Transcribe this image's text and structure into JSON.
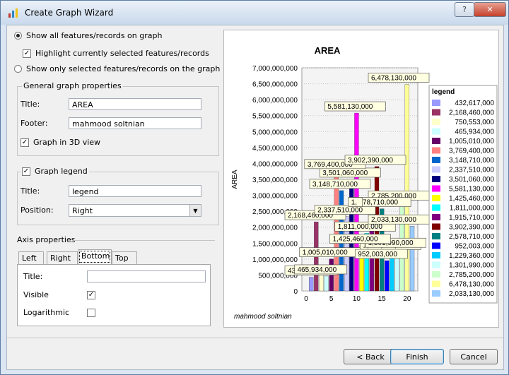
{
  "window": {
    "title": "Create Graph Wizard",
    "help_label": "?",
    "close_label": "✕"
  },
  "options": {
    "show_all": "Show all features/records on graph",
    "highlight": "Highlight currently selected features/records",
    "show_selected": "Show only selected features/records on the graph"
  },
  "general": {
    "group_title": "General graph properties",
    "title_label": "Title:",
    "title_value": "AREA",
    "footer_label": "Footer:",
    "footer_value": "mahmood soltnian",
    "graph3d_label": "Graph in 3D view"
  },
  "legend_group": {
    "checkbox_label": "Graph legend",
    "title_label": "Title:",
    "title_value": "legend",
    "position_label": "Position:",
    "position_value": "Right",
    "dropdown_glyph": "▼"
  },
  "axis": {
    "group_title": "Axis properties",
    "tabs": [
      "Left",
      "Right",
      "Bottom",
      "Top"
    ],
    "title_label": "Title:",
    "title_value": "",
    "visible_label": "Visible",
    "logarithmic_label": "Logarithmic",
    "check_glyph": "✓"
  },
  "buttons": {
    "back": "< Back",
    "finish": "Finish",
    "cancel": "Cancel"
  },
  "chart_data": {
    "type": "bar",
    "title": "AREA",
    "footer": "mahmood soltnian",
    "ylabel": "AREA",
    "ylim": [
      0,
      7000000000
    ],
    "yticks": [
      "0",
      "500,000,000",
      "1,000,000,000",
      "1,500,000,000",
      "2,000,000,000",
      "2,500,000,000",
      "3,000,000,000",
      "3,500,000,000",
      "4,000,000,000",
      "4,500,000,000",
      "5,000,000,000",
      "5,500,000,000",
      "6,000,000,000",
      "6,500,000,000",
      "7,000,000,000"
    ],
    "xlim": [
      0,
      21
    ],
    "xticks": [
      "0",
      "5",
      "10",
      "15",
      "20"
    ],
    "legend_title": "legend",
    "legend_position": "right",
    "series": [
      {
        "name": "432,617,000",
        "x": 1,
        "value": 432617000,
        "color": "#9999ff"
      },
      {
        "name": "2,168,460,000",
        "x": 2,
        "value": 2168460000,
        "color": "#993366"
      },
      {
        "name": "750,553,000",
        "x": 3,
        "value": 750553000,
        "color": "#ffffcc"
      },
      {
        "name": "465,934,000",
        "x": 4,
        "value": 465934000,
        "color": "#ccffff"
      },
      {
        "name": "1,005,010,000",
        "x": 5,
        "value": 1005010000,
        "color": "#660066"
      },
      {
        "name": "3,769,400,000",
        "x": 6,
        "value": 3769400000,
        "color": "#ff8080"
      },
      {
        "name": "3,148,710,000",
        "x": 7,
        "value": 3148710000,
        "color": "#0066cc"
      },
      {
        "name": "2,337,510,000",
        "x": 8,
        "value": 2337510000,
        "color": "#ccccff"
      },
      {
        "name": "3,501,060,000",
        "x": 9,
        "value": 3501060000,
        "color": "#000080"
      },
      {
        "name": "5,581,130,000",
        "x": 10,
        "value": 5581130000,
        "color": "#ff00ff"
      },
      {
        "name": "1,425,460,000",
        "x": 11,
        "value": 1425460000,
        "color": "#ffff00"
      },
      {
        "name": "1,811,000,000",
        "x": 12,
        "value": 1811000000,
        "color": "#00ffff"
      },
      {
        "name": "1,915,710,000",
        "x": 13,
        "value": 1915710000,
        "color": "#800080"
      },
      {
        "name": "3,902,390,000",
        "x": 14,
        "value": 3902390000,
        "color": "#800000"
      },
      {
        "name": "2,578,710,000",
        "x": 15,
        "value": 2578710000,
        "color": "#008080"
      },
      {
        "name": "952,003,000",
        "x": 16,
        "value": 952003000,
        "color": "#0000ff"
      },
      {
        "name": "1,229,360,000",
        "x": 17,
        "value": 1229360000,
        "color": "#00ccff"
      },
      {
        "name": "1,301,990,000",
        "x": 18,
        "value": 1301990000,
        "color": "#ccffff"
      },
      {
        "name": "2,785,200,000",
        "x": 19,
        "value": 2785200000,
        "color": "#ccffcc"
      },
      {
        "name": "6,478,130,000",
        "x": 20,
        "value": 6478130000,
        "color": "#ffff99"
      },
      {
        "name": "2,033,130,000",
        "x": 21,
        "value": 2033130000,
        "color": "#99ccff"
      }
    ],
    "callouts": [
      "432,617,000",
      "465,934,000",
      "1,005,010,000",
      "2,168,460,000",
      "2,337,510,000",
      "3,148,710,000",
      "3,501,060,000",
      "3,769,400,000",
      "5,581,130,000",
      "3,902,390,000",
      "6,478,130,000",
      "2,785,200,000",
      "2,578,710,000",
      "1,",
      "1,811,000,000",
      "2,033,130,000",
      "1,229,360,000",
      "1,301,990,000",
      "1,425,460,000",
      "952,003,000"
    ]
  }
}
